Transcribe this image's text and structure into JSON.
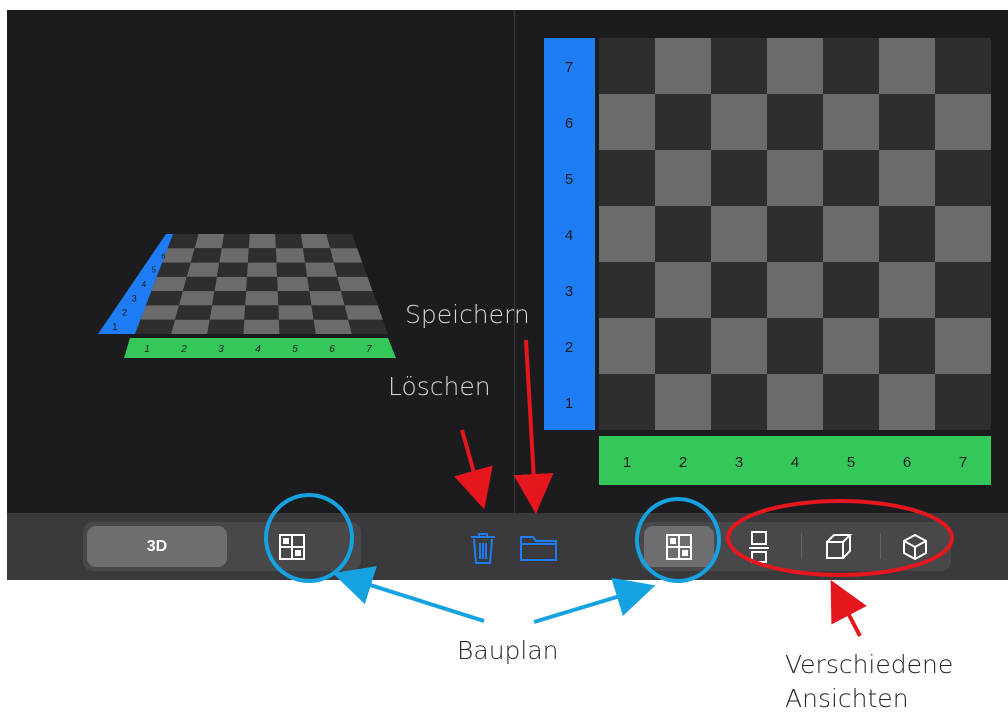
{
  "toolbar": {
    "mode_label": "3D",
    "left_group": [
      "3d",
      "blueprint"
    ],
    "center_icons": [
      "trash-icon",
      "folder-icon"
    ],
    "right_group": [
      "blueprint-view",
      "side-view",
      "cube-view",
      "iso-view"
    ]
  },
  "grid2d": {
    "rows": [
      "7",
      "6",
      "5",
      "4",
      "3",
      "2",
      "1"
    ],
    "cols": [
      "1",
      "2",
      "3",
      "4",
      "5",
      "6",
      "7"
    ],
    "row_color": "#1e7cf5",
    "col_color": "#34c759",
    "light": "#6b6b6b",
    "dark": "#2e2e2e"
  },
  "grid3d": {
    "rows": [
      "1",
      "2",
      "3",
      "4",
      "5",
      "6",
      "7"
    ],
    "cols": [
      "1",
      "2",
      "3",
      "4",
      "5",
      "6",
      "7"
    ]
  },
  "annotations": {
    "speichern": "Speichern",
    "loeschen": "Löschen",
    "bauplan": "Bauplan",
    "verschiedene_line1": "Verschiedene",
    "verschiedene_line2": "Ansichten"
  },
  "colors": {
    "accent_blue": "#1e7cf5",
    "annot_red": "#e5161d",
    "annot_cyan": "#14a3e0"
  }
}
